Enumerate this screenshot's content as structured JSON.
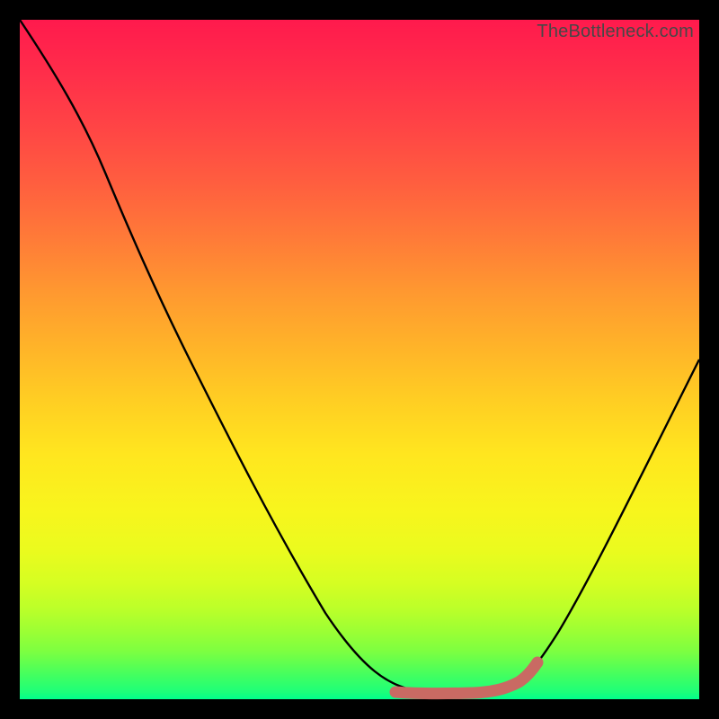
{
  "watermark": "TheBottleneck.com",
  "colors": {
    "curve": "#000000",
    "highlight": "#c96a63",
    "background": "#000000"
  },
  "chart_data": {
    "type": "line",
    "title": "",
    "xlabel": "",
    "ylabel": "",
    "xlim": [
      0,
      100
    ],
    "ylim": [
      0,
      100
    ],
    "grid": false,
    "legend": false,
    "series": [
      {
        "name": "bottleneck-curve",
        "x": [
          0,
          2,
          6,
          12,
          20,
          30,
          40,
          50,
          55,
          58,
          62,
          66,
          70,
          72,
          74,
          78,
          84,
          90,
          96,
          100
        ],
        "y": [
          100,
          98,
          94,
          87,
          76,
          61,
          45,
          27,
          17,
          10,
          5,
          2,
          1,
          0.5,
          1,
          5,
          15,
          28,
          42,
          52
        ]
      },
      {
        "name": "optimal-range-highlight",
        "x": [
          55,
          60,
          65,
          70,
          72,
          74
        ],
        "y": [
          0.5,
          0.3,
          0.2,
          0.3,
          0.8,
          2.5
        ]
      }
    ],
    "annotations": []
  }
}
